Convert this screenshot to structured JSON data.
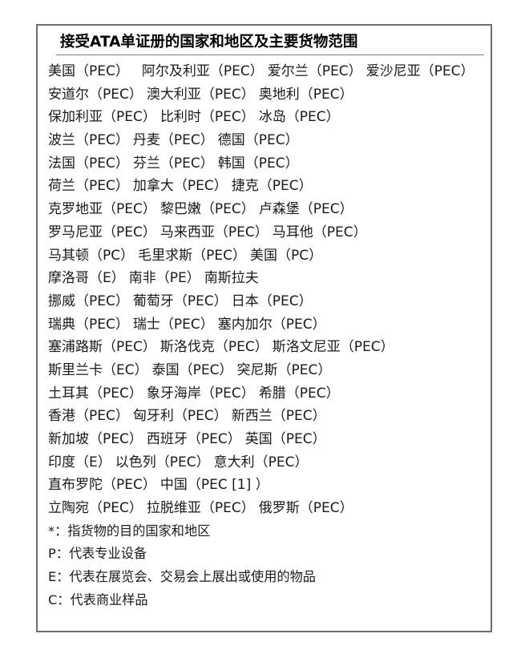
{
  "document": {
    "title": "接受ATA单证册的国家和地区及主要货物范围"
  },
  "entries_rows": [
    {
      "id": "row-1",
      "wide_gap_after_first": true,
      "items": [
        {
          "name": "美国",
          "scope": "（PEC）"
        },
        {
          "name": "阿尔及利亚",
          "scope": "（PEC）"
        },
        {
          "name": "爱尔兰",
          "scope": "（PEC）"
        },
        {
          "name": "爱沙尼亚",
          "scope": "（PEC）"
        }
      ]
    },
    {
      "id": "row-2",
      "wide_gap_after_first": false,
      "items": [
        {
          "name": "安道尔",
          "scope": "（PEC）"
        },
        {
          "name": "澳大利亚",
          "scope": "（PEC）"
        },
        {
          "name": "奥地利",
          "scope": "（PEC）"
        }
      ]
    },
    {
      "id": "row-3",
      "wide_gap_after_first": false,
      "items": [
        {
          "name": "保加利亚",
          "scope": "（PEC）"
        },
        {
          "name": "比利时",
          "scope": "（PEC）"
        },
        {
          "name": "冰岛",
          "scope": "（PEC）"
        }
      ]
    },
    {
      "id": "row-4",
      "wide_gap_after_first": false,
      "items": [
        {
          "name": "波兰",
          "scope": "（PEC）"
        },
        {
          "name": "丹麦",
          "scope": "（PEC）"
        },
        {
          "name": "德国",
          "scope": "（PEC）"
        }
      ]
    },
    {
      "id": "row-5",
      "wide_gap_after_first": false,
      "items": [
        {
          "name": "法国",
          "scope": "（PEC）"
        },
        {
          "name": "芬兰",
          "scope": "（PEC）"
        },
        {
          "name": "韩国",
          "scope": "（PEC）"
        }
      ]
    },
    {
      "id": "row-6",
      "wide_gap_after_first": false,
      "items": [
        {
          "name": "荷兰",
          "scope": "（PEC）"
        },
        {
          "name": "加拿大",
          "scope": "（PEC）"
        },
        {
          "name": "捷克",
          "scope": "（PEC）"
        }
      ]
    },
    {
      "id": "row-7",
      "wide_gap_after_first": false,
      "items": [
        {
          "name": "克罗地亚",
          "scope": "（PEC）"
        },
        {
          "name": "黎巴嫩",
          "scope": "（PEC）"
        },
        {
          "name": "卢森堡",
          "scope": "（PEC）"
        }
      ]
    },
    {
      "id": "row-8",
      "wide_gap_after_first": false,
      "items": [
        {
          "name": "罗马尼亚",
          "scope": "（PEC）"
        },
        {
          "name": "马来西亚",
          "scope": "（PEC）"
        },
        {
          "name": "马耳他",
          "scope": "（PEC）"
        }
      ]
    },
    {
      "id": "row-9",
      "wide_gap_after_first": false,
      "items": [
        {
          "name": "马其顿",
          "scope": "（PC）"
        },
        {
          "name": "毛里求斯",
          "scope": "（PEC）"
        },
        {
          "name": "美国",
          "scope": "（PC）"
        }
      ]
    },
    {
      "id": "row-10",
      "wide_gap_after_first": false,
      "items": [
        {
          "name": "摩洛哥",
          "scope": "（E）"
        },
        {
          "name": "南非",
          "scope": "（PE）"
        },
        {
          "name": "南斯拉夫",
          "scope": ""
        }
      ]
    },
    {
      "id": "row-11",
      "wide_gap_after_first": false,
      "items": [
        {
          "name": "挪威",
          "scope": "（PEC）"
        },
        {
          "name": "葡萄牙",
          "scope": "（PEC）"
        },
        {
          "name": "日本",
          "scope": "（PEC）"
        }
      ]
    },
    {
      "id": "row-12",
      "wide_gap_after_first": false,
      "items": [
        {
          "name": "瑞典",
          "scope": "（PEC）"
        },
        {
          "name": "瑞士",
          "scope": "（PEC）"
        },
        {
          "name": "塞内加尔",
          "scope": "（PEC）"
        }
      ]
    },
    {
      "id": "row-13",
      "wide_gap_after_first": false,
      "items": [
        {
          "name": "塞浦路斯",
          "scope": "（PEC）"
        },
        {
          "name": "斯洛伐克",
          "scope": "（PEC）"
        },
        {
          "name": "斯洛文尼亚",
          "scope": "（PEC）"
        }
      ]
    },
    {
      "id": "row-14",
      "wide_gap_after_first": false,
      "items": [
        {
          "name": "斯里兰卡",
          "scope": "（EC）"
        },
        {
          "name": "泰国",
          "scope": "（PEC）"
        },
        {
          "name": "突尼斯",
          "scope": "（PEC）"
        }
      ]
    },
    {
      "id": "row-15",
      "wide_gap_after_first": false,
      "items": [
        {
          "name": "土耳其",
          "scope": "（PEC）"
        },
        {
          "name": "象牙海岸",
          "scope": "（PEC）"
        },
        {
          "name": "希腊",
          "scope": "（PEC）"
        }
      ]
    },
    {
      "id": "row-16",
      "wide_gap_after_first": false,
      "items": [
        {
          "name": "香港",
          "scope": "（PEC）"
        },
        {
          "name": "匈牙利",
          "scope": "（PEC）"
        },
        {
          "name": "新西兰",
          "scope": "（PEC）"
        }
      ]
    },
    {
      "id": "row-17",
      "wide_gap_after_first": false,
      "items": [
        {
          "name": "新加坡",
          "scope": "（PEC）"
        },
        {
          "name": "西班牙",
          "scope": "（PEC）"
        },
        {
          "name": "英国",
          "scope": "（PEC）"
        }
      ]
    },
    {
      "id": "row-18",
      "wide_gap_after_first": false,
      "items": [
        {
          "name": "印度",
          "scope": "（E）"
        },
        {
          "name": "以色列",
          "scope": "（PEC）"
        },
        {
          "name": "意大利",
          "scope": "（PEC）"
        }
      ]
    },
    {
      "id": "row-19",
      "wide_gap_after_first": false,
      "items": [
        {
          "name": "直布罗陀",
          "scope": "（PEC）"
        },
        {
          "name": "中国",
          "scope": "（PEC [1]  ）"
        }
      ]
    },
    {
      "id": "row-20",
      "wide_gap_after_first": false,
      "items": [
        {
          "name": "立陶宛",
          "scope": "（PEC）"
        },
        {
          "name": "拉脱维亚",
          "scope": "（PEC）"
        },
        {
          "name": "俄罗斯",
          "scope": "（PEC）"
        }
      ]
    }
  ],
  "notes": [
    {
      "id": "note-asterisk",
      "text": "*：指货物的目的国家和地区"
    },
    {
      "id": "note-p",
      "text": "P：代表专业设备"
    },
    {
      "id": "note-e",
      "text": "E：代表在展览会、交易会上展出或使用的物品"
    },
    {
      "id": "note-c",
      "text": "C：代表商业样品"
    }
  ],
  "colors": {
    "border": "#6e6e6e",
    "rule": "#808080",
    "text": "#1a1a1a",
    "title_text": "#000000",
    "background": "#ffffff"
  }
}
